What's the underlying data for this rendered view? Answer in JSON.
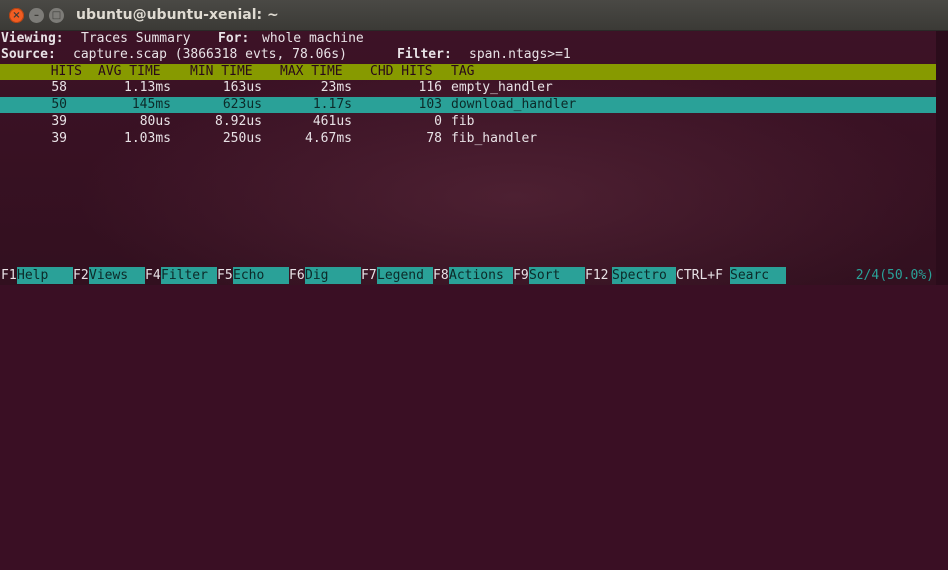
{
  "window": {
    "title": "ubuntu@ubuntu-xenial: ~"
  },
  "info": {
    "viewing_label": "Viewing:",
    "viewing_value": "Traces Summary",
    "for_label": "For:",
    "for_value": "whole machine",
    "source_label": "Source:",
    "source_value": "capture.scap (3866318 evts, 78.06s)",
    "filter_label": "Filter:",
    "filter_value": "span.ntags>=1"
  },
  "table": {
    "headers": [
      "HITS",
      "AVG TIME",
      "MIN TIME",
      "MAX TIME",
      "CHD HITS",
      "TAG"
    ],
    "rows": [
      {
        "hits": "58",
        "avg": "1.13ms",
        "min": "163us",
        "max": "23ms",
        "chd": "116",
        "tag": "empty_handler"
      },
      {
        "hits": "50",
        "avg": "145ms",
        "min": "623us",
        "max": "1.17s",
        "chd": "103",
        "tag": "download_handler"
      },
      {
        "hits": "39",
        "avg": "80us",
        "min": "8.92us",
        "max": "461us",
        "chd": "0",
        "tag": "fib"
      },
      {
        "hits": "39",
        "avg": "1.03ms",
        "min": "250us",
        "max": "4.67ms",
        "chd": "78",
        "tag": "fib_handler"
      }
    ],
    "selected_index": 1
  },
  "footer": {
    "keys": [
      {
        "key": "F1",
        "label": "Help"
      },
      {
        "key": "F2",
        "label": "Views"
      },
      {
        "key": "F4",
        "label": "Filter"
      },
      {
        "key": "F5",
        "label": "Echo"
      },
      {
        "key": "F6",
        "label": "Dig"
      },
      {
        "key": "F7",
        "label": "Legend"
      },
      {
        "key": "F8",
        "label": "Actions"
      },
      {
        "key": "F9",
        "label": "Sort"
      },
      {
        "key": "F12",
        "label": "Spectro"
      },
      {
        "key": "CTRL+F",
        "label": "Searc"
      }
    ],
    "status": "2/4(50.0%)"
  },
  "colors": {
    "header_bg": "#879a00",
    "selection_bg": "#2aa198",
    "terminal_bg": "#3a0f24",
    "close_button": "#f15d22"
  }
}
